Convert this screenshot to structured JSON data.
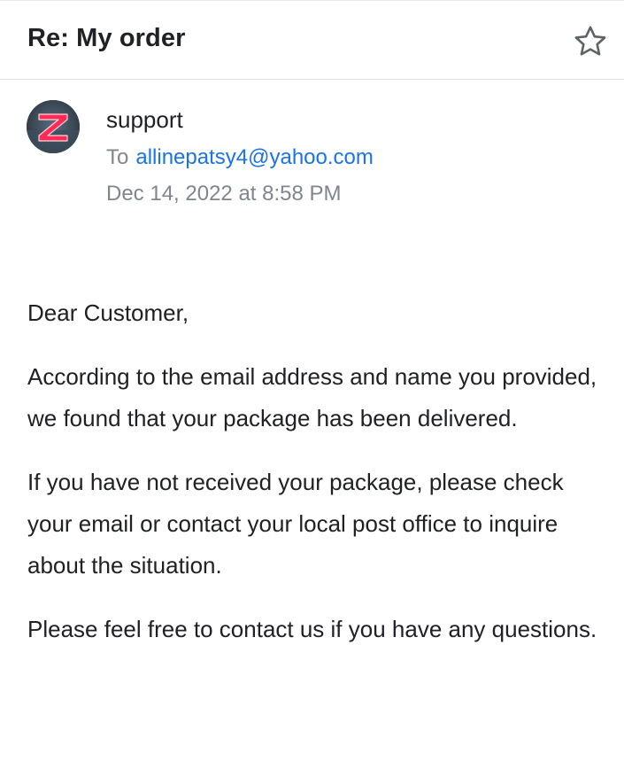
{
  "email": {
    "subject": "Re: My order",
    "sender": {
      "name": "support",
      "avatar_letter": "Z"
    },
    "recipient": {
      "label": "To",
      "address": "allinepatsy4@yahoo.com"
    },
    "date": "Dec 14, 2022 at 8:58 PM",
    "body": {
      "greeting": "Dear Customer,",
      "paragraphs": [
        "According to the email address and name you provided, we found that your package has been delivered.",
        "If you have not received your package, please check your email or contact your local post office to inquire about the situation.",
        "Please feel free to contact us if you have any questions."
      ]
    }
  },
  "icons": {
    "star": "star-outline-icon"
  },
  "colors": {
    "link": "#1a73e8",
    "muted": "#80868b",
    "text": "#202124",
    "avatar_letter": "#ff2a55"
  }
}
